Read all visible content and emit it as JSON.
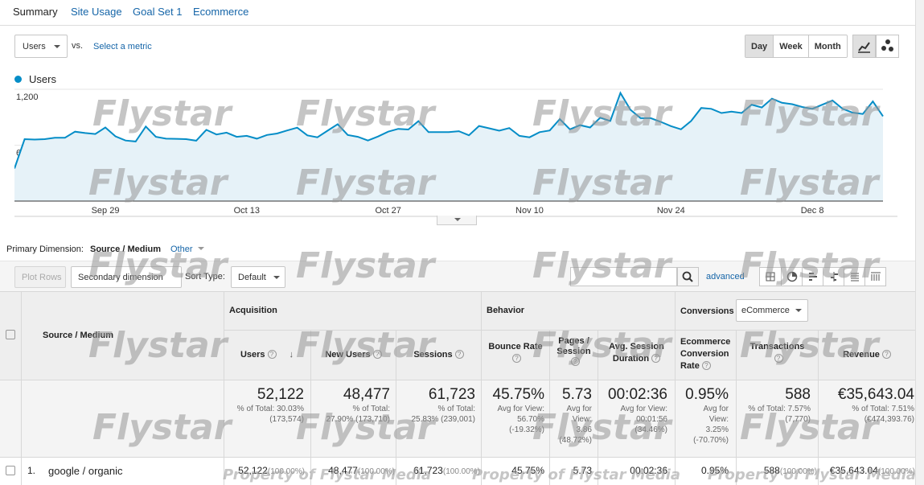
{
  "tabs": [
    "Summary",
    "Site Usage",
    "Goal Set 1",
    "Ecommerce"
  ],
  "controls": {
    "metric": "Users",
    "vs": "vs.",
    "select_metric": "Select a metric",
    "granularity": [
      "Day",
      "Week",
      "Month"
    ],
    "active_granularity": "Day"
  },
  "chart_data": {
    "type": "area",
    "series": [
      {
        "name": "Users",
        "color": "#058dc7"
      }
    ],
    "y_ticks": [
      "1,200",
      "600"
    ],
    "ylim": [
      0,
      1200
    ],
    "x_ticks": [
      "Sep 29",
      "Oct 13",
      "Oct 27",
      "Nov 10",
      "Nov 24",
      "Dec 8"
    ],
    "values": [
      350,
      665,
      660,
      665,
      680,
      680,
      745,
      730,
      720,
      790,
      695,
      650,
      640,
      800,
      690,
      670,
      668,
      665,
      648,
      765,
      715,
      735,
      690,
      700,
      670,
      710,
      725,
      758,
      788,
      705,
      685,
      755,
      825,
      710,
      690,
      650,
      693,
      745,
      775,
      768,
      858,
      740,
      740,
      740,
      750,
      706,
      806,
      781,
      755,
      784,
      700,
      685,
      740,
      758,
      880,
      770,
      815,
      790,
      895,
      860,
      1160,
      980,
      890,
      890,
      850,
      805,
      770,
      860,
      1000,
      990,
      945,
      960,
      945,
      1035,
      1005,
      1100,
      1055,
      1040,
      1010,
      990,
      1035,
      1080,
      990,
      950,
      935,
      1070,
      910
    ],
    "grid": true,
    "legend": "top-left"
  },
  "primary_dimension": {
    "label": "Primary Dimension:",
    "value": "Source / Medium",
    "other": "Other"
  },
  "toolbar": {
    "plot_rows": "Plot Rows",
    "secondary_dimension": "Secondary dimension",
    "sort_type_label": "Sort Type:",
    "sort_type": "Default",
    "advanced": "advanced"
  },
  "table": {
    "dimension_header": "Source / Medium",
    "groups": {
      "acquisition": "Acquisition",
      "behavior": "Behavior",
      "conversions": "Conversions",
      "conversions_select": "eCommerce"
    },
    "columns": {
      "users": "Users",
      "new_users": "New Users",
      "sessions": "Sessions",
      "bounce_rate": "Bounce Rate",
      "pages_session": "Pages / Session",
      "avg_session_duration": "Avg. Session Duration",
      "ecommerce_conversion_rate": "Ecommerce Conversion Rate",
      "transactions": "Transactions",
      "revenue": "Revenue"
    },
    "totals": {
      "users": {
        "value": "52,122",
        "sub1": "% of Total: 30.03%",
        "sub2": "(173,574)"
      },
      "new_users": {
        "value": "48,477",
        "sub1": "% of Total:",
        "sub2": "27.90% (173,710)"
      },
      "sessions": {
        "value": "61,723",
        "sub1": "% of Total:",
        "sub2": "25.83% (239,001)"
      },
      "bounce_rate": {
        "value": "45.75%",
        "sub1": "Avg for View:",
        "sub2": "56.70%",
        "sub3": "(-19.32%)"
      },
      "pages_session": {
        "value": "5.73",
        "sub1": "Avg for",
        "sub2": "View:",
        "sub3": "3.86",
        "sub4": "(48.72%)"
      },
      "avg_session_duration": {
        "value": "00:02:36",
        "sub1": "Avg for View:",
        "sub2": "00:01:56",
        "sub3": "(34.46%)"
      },
      "ecommerce_conversion_rate": {
        "value": "0.95%",
        "sub1": "Avg for",
        "sub2": "View:",
        "sub3": "3.25%",
        "sub4": "(-70.70%)"
      },
      "transactions": {
        "value": "588",
        "sub1": "% of Total: 7.57%",
        "sub2": "(7,770)"
      },
      "revenue": {
        "value": "€35,643.04",
        "sub1": "% of Total: 7.51%",
        "sub2": "(€474,393.76)"
      }
    },
    "rows": [
      {
        "index": "1.",
        "source": "google / organic",
        "users": "52,122",
        "users_pct": "(100.00%)",
        "new_users": "48,477",
        "new_users_pct": "(100.00%)",
        "sessions": "61,723",
        "sessions_pct": "(100.00%)",
        "bounce_rate": "45.75%",
        "pages_session": "5.73",
        "avg_session_duration": "00:02:36",
        "ecommerce_conversion_rate": "0.95%",
        "transactions": "588",
        "transactions_pct": "(100.00%)",
        "revenue": "€35,643.04",
        "revenue_pct": "(100.00%)"
      }
    ]
  },
  "watermark": {
    "brand": "Flystar",
    "footer": "Property of Flystar Media"
  }
}
